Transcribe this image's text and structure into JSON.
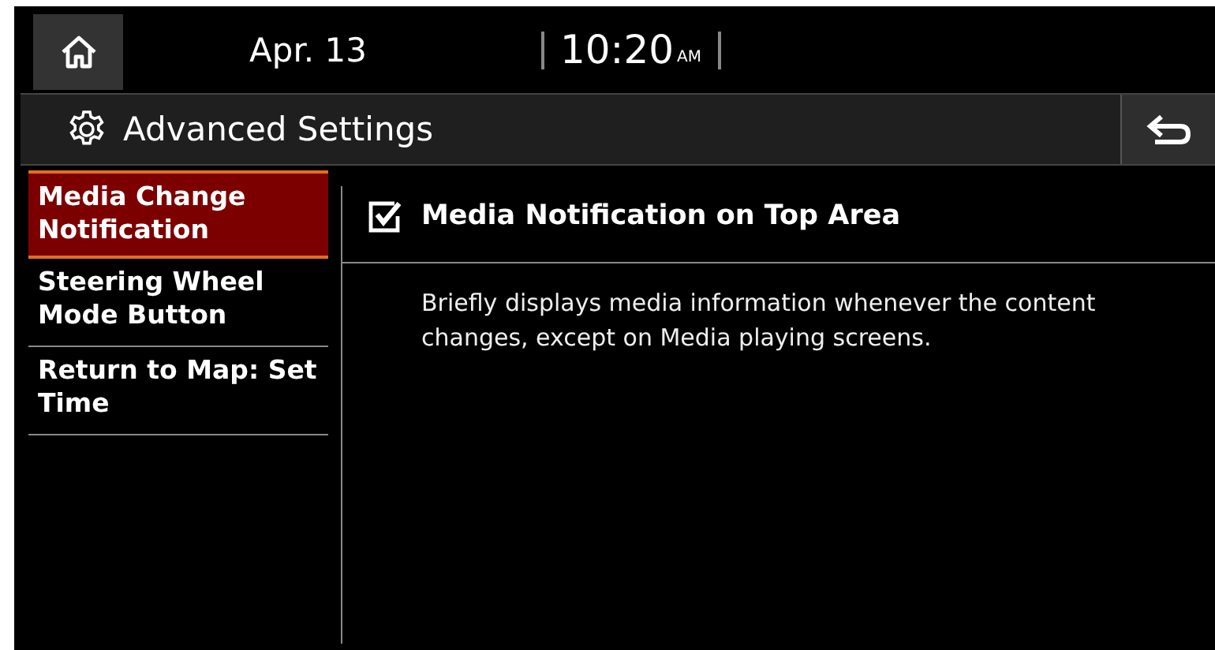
{
  "status_bar": {
    "date": "Apr. 13",
    "time": "10:20",
    "meridiem": "AM"
  },
  "header": {
    "title": "Advanced Settings"
  },
  "sidebar": {
    "items": [
      {
        "label": "Media Change Notification",
        "selected": true
      },
      {
        "label": "Steering Wheel Mode Button",
        "selected": false
      },
      {
        "label": "Return to Map: Set Time",
        "selected": false
      }
    ]
  },
  "content": {
    "option": {
      "label": "Media Notification on Top Area",
      "checked": true
    },
    "description": "Briefly displays media information whenever the content changes, except on Media playing screens."
  }
}
